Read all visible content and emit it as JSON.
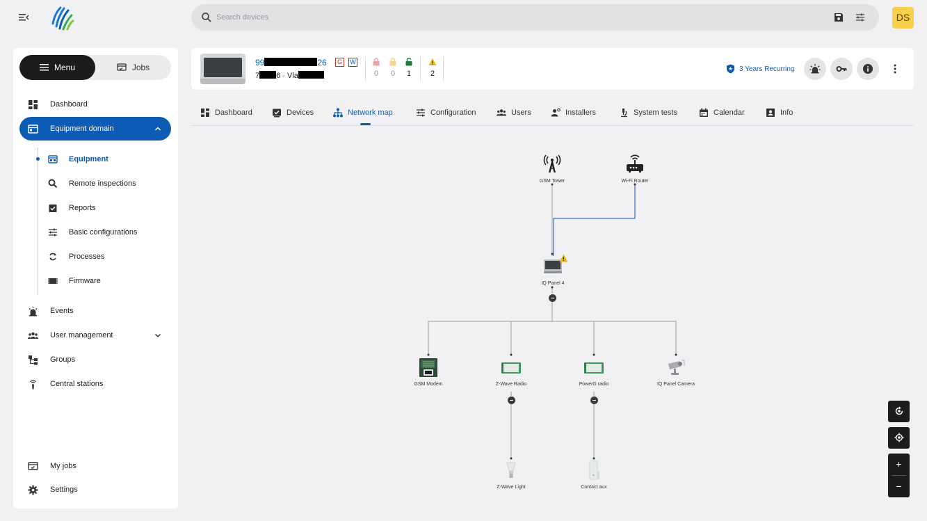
{
  "search": {
    "placeholder": "Search devices"
  },
  "user": {
    "initials": "DS"
  },
  "sidebar": {
    "segment": {
      "menu_label": "Menu",
      "jobs_label": "Jobs"
    },
    "items": [
      {
        "label": "Dashboard"
      },
      {
        "label": "Equipment domain"
      },
      {
        "label": "Events"
      },
      {
        "label": "User management"
      },
      {
        "label": "Groups"
      },
      {
        "label": "Central stations"
      },
      {
        "label": "My jobs"
      },
      {
        "label": "Settings"
      }
    ],
    "sub_items": [
      {
        "label": "Equipment"
      },
      {
        "label": "Remote inspections"
      },
      {
        "label": "Reports"
      },
      {
        "label": "Basic configurations"
      },
      {
        "label": "Processes"
      },
      {
        "label": "Firmware"
      }
    ]
  },
  "device": {
    "id_prefix": "99",
    "id_suffix": "26",
    "sub_prefix": "7",
    "sub_mid": "6 · Vla",
    "badge_g": "G",
    "badge_w": "W",
    "stats": [
      {
        "icon": "lock-red-icon",
        "value": "0",
        "color": "#e8a3a3"
      },
      {
        "icon": "lock-yellow-icon",
        "value": "0",
        "color": "#f2d58c"
      },
      {
        "icon": "lock-green-icon",
        "value": "1",
        "color": "#1e7d32"
      },
      {
        "icon": "warning-icon",
        "value": "2",
        "color": "#f5b800"
      }
    ],
    "plan": "3 Years Recurring"
  },
  "tabs": [
    {
      "label": "Dashboard"
    },
    {
      "label": "Devices"
    },
    {
      "label": "Network map"
    },
    {
      "label": "Configuration"
    },
    {
      "label": "Users"
    },
    {
      "label": "Installers"
    },
    {
      "label": "System tests"
    },
    {
      "label": "Calendar"
    },
    {
      "label": "Info"
    }
  ],
  "network": {
    "nodes": {
      "gsm_tower": "GSM Tower",
      "wifi_router": "Wi-Fi Router",
      "panel": "IQ Panel 4",
      "gsm_modem": "GSM Modem",
      "zwave_radio": "Z-Wave Radio",
      "powerg_radio": "PowerG radio",
      "panel_camera": "IQ Panel Camera",
      "zwave_light": "Z-Wave Light",
      "contact_aux": "Contact aux"
    }
  },
  "map_controls": {
    "zoom_in": "+",
    "zoom_out": "−"
  },
  "colors": {
    "accent": "#0c5bb5",
    "warning": "#f5b800",
    "dark": "#1c1c1e"
  }
}
